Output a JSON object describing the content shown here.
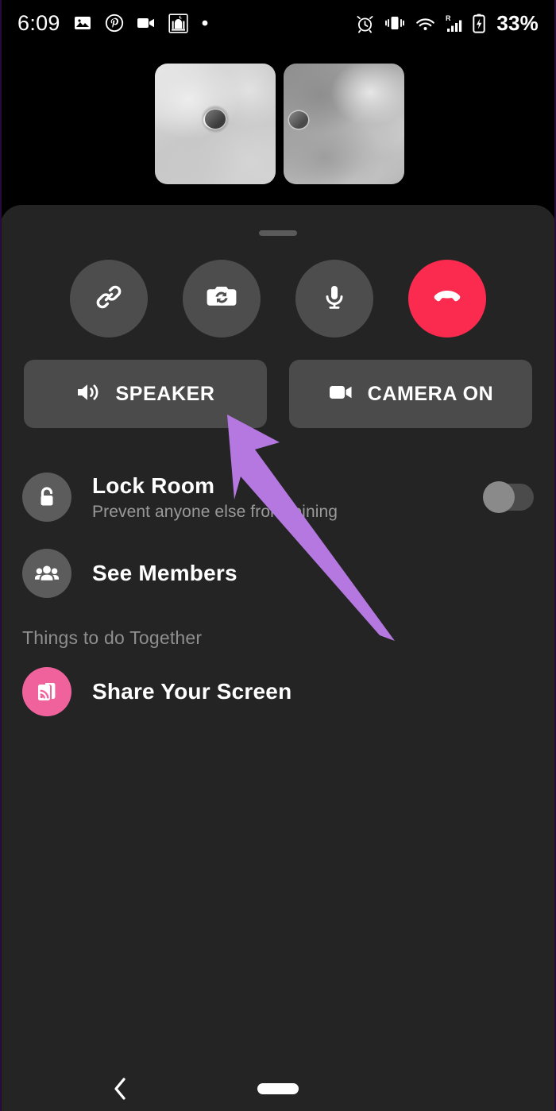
{
  "status_bar": {
    "time": "6:09",
    "battery_percent": "33%",
    "roaming_label": "R",
    "left_icons": [
      "gallery-icon",
      "pinterest-icon",
      "video-camera-icon",
      "prayer-app-icon",
      "notification-dot-icon"
    ],
    "right_icons": [
      "alarm-icon",
      "vibrate-icon",
      "wifi-icon",
      "signal-bars-icon",
      "battery-charging-icon"
    ]
  },
  "video_grid": {
    "tiles": [
      {
        "name": "self-video-tile",
        "label": ""
      },
      {
        "name": "remote-video-tile",
        "label": ""
      }
    ]
  },
  "sheet": {
    "handle_label": "",
    "controls": [
      {
        "name": "share-link-button",
        "icon": "link-icon",
        "label": ""
      },
      {
        "name": "flip-camera-button",
        "icon": "camera-flip-icon",
        "label": ""
      },
      {
        "name": "mute-microphone-button",
        "icon": "microphone-icon",
        "label": ""
      },
      {
        "name": "end-call-button",
        "icon": "phone-hangup-icon",
        "label": ""
      }
    ],
    "pills": [
      {
        "name": "speaker-toggle-button",
        "icon": "speaker-icon",
        "label": "SPEAKER"
      },
      {
        "name": "camera-toggle-button",
        "icon": "video-camera-icon",
        "label": "CAMERA ON"
      }
    ],
    "rows": [
      {
        "name": "lock-room-row",
        "icon": "unlock-icon",
        "title": "Lock Room",
        "subtitle": "Prevent anyone else from joining",
        "has_toggle": true,
        "toggle_state": "off"
      },
      {
        "name": "see-members-row",
        "icon": "group-people-icon",
        "title": "See Members",
        "subtitle": "",
        "has_toggle": false
      }
    ],
    "section_title": "Things to do Together",
    "activities": [
      {
        "name": "share-your-screen-row",
        "icon": "screen-cast-icon",
        "title": "Share Your Screen"
      }
    ]
  },
  "annotation": {
    "type": "arrow",
    "points_to": "speaker-toggle-button",
    "color": "#b478e0"
  },
  "nav_bar": {
    "back_label": "back-icon",
    "home_label": "home-indicator"
  },
  "colors": {
    "sheet_background": "#242424",
    "screen_background": "#000000",
    "control_button": "#4d4d4d",
    "end_call_red": "#fa2b4e",
    "pill_background": "#4b4b4b",
    "share_screen_pink": "#f0629c",
    "annotation_purple": "#b478e0",
    "subtitle_gray": "#9a9a9a"
  }
}
